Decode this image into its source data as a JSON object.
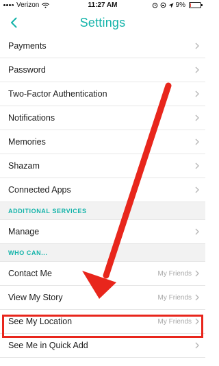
{
  "status": {
    "carrier": "Verizon",
    "time": "11:27 AM",
    "battery": "9%",
    "battery_level": 0.09
  },
  "nav": {
    "title": "Settings",
    "back_icon": "chevron-left-icon",
    "accent": "#12b3a9"
  },
  "rows_top": [
    {
      "label": "Payments"
    },
    {
      "label": "Password"
    },
    {
      "label": "Two-Factor Authentication"
    },
    {
      "label": "Notifications"
    },
    {
      "label": "Memories"
    },
    {
      "label": "Shazam"
    },
    {
      "label": "Connected Apps"
    }
  ],
  "section_additional": "ADDITIONAL SERVICES",
  "rows_additional": [
    {
      "label": "Manage"
    }
  ],
  "section_who": "WHO CAN...",
  "rows_who": [
    {
      "label": "Contact Me",
      "value": "My Friends"
    },
    {
      "label": "View My Story",
      "value": "My Friends"
    },
    {
      "label": "See My Location",
      "value": "My Friends"
    },
    {
      "label": "See Me in Quick Add",
      "value": ""
    }
  ],
  "annotation": {
    "highlight_color": "#e8261c"
  }
}
